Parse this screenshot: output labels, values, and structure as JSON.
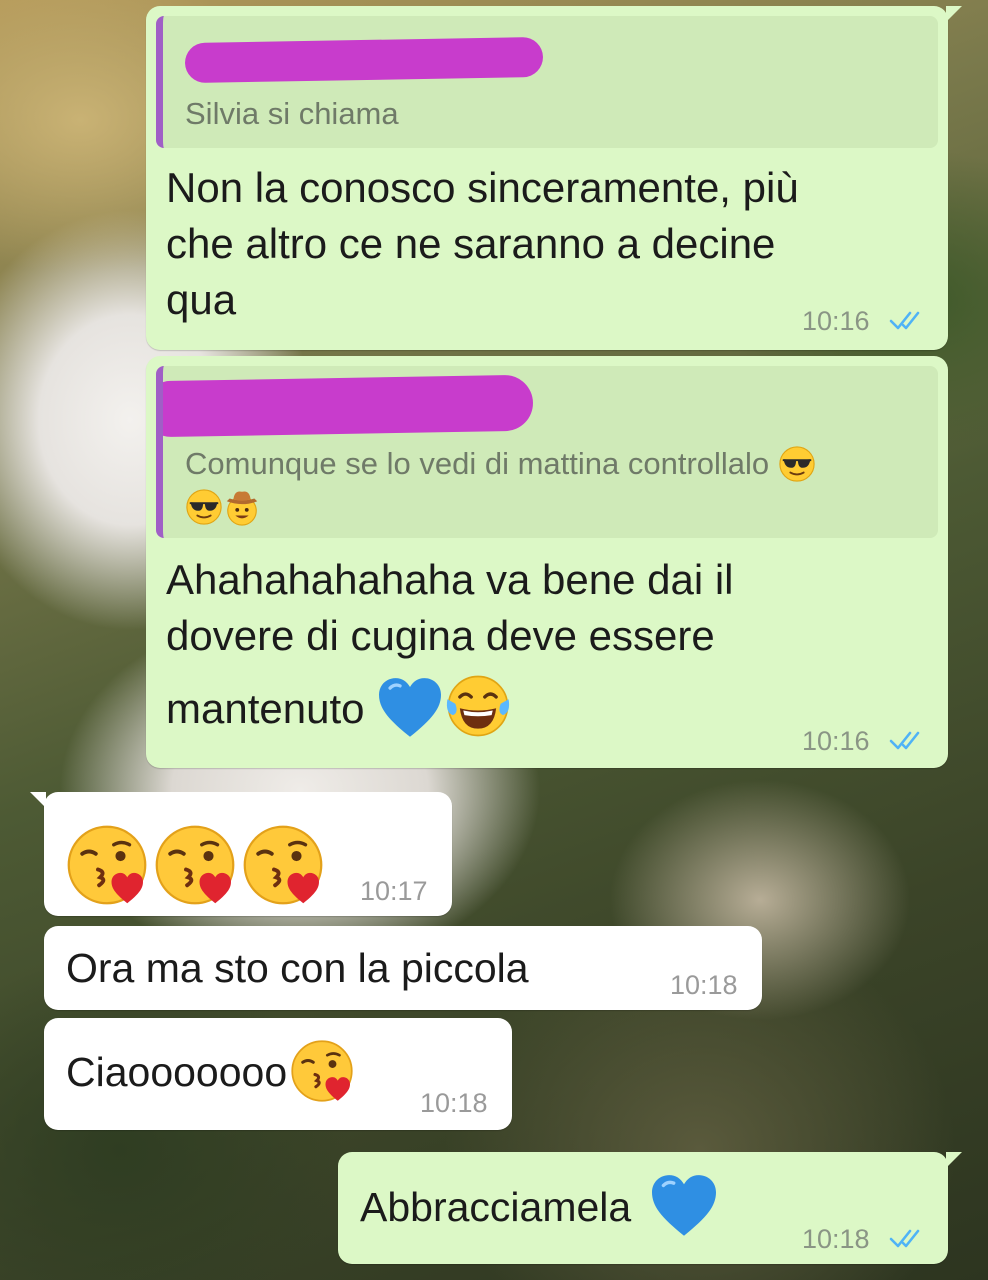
{
  "messages": [
    {
      "direction": "outgoing",
      "quote": {
        "text": "Silvia si chiama"
      },
      "text": "Non la conosco sinceramente, più che altro ce ne saranno a decine qua",
      "lines": [
        "Non la conosco sinceramente, più",
        "che altro ce ne saranno a decine",
        "qua"
      ],
      "time": "10:16",
      "status": "read"
    },
    {
      "direction": "outgoing",
      "quote": {
        "text": "Comunque se lo vedi di mattina controllalo",
        "emojis": [
          "smiling-face-with-sunglasses",
          "smiling-face-with-sunglasses",
          "cowboy-hat-face"
        ]
      },
      "text": "Ahahahahahaha va bene dai il dovere di cugina deve essere mantenuto",
      "lines": [
        "Ahahahahahaha va bene dai il",
        "dovere di cugina deve essere",
        "mantenuto"
      ],
      "emojis": [
        "blue-heart",
        "face-with-tears-of-joy"
      ],
      "time": "10:16",
      "status": "read"
    },
    {
      "direction": "incoming",
      "emojis": [
        "face-blowing-a-kiss",
        "face-blowing-a-kiss",
        "face-blowing-a-kiss"
      ],
      "time": "10:17"
    },
    {
      "direction": "incoming",
      "text": "Ora ma sto con la piccola",
      "time": "10:18"
    },
    {
      "direction": "incoming",
      "text": "Ciaooooooo",
      "emojis": [
        "face-blowing-a-kiss"
      ],
      "time": "10:18"
    },
    {
      "direction": "outgoing",
      "text": "Abbracciamela",
      "emojis": [
        "blue-heart"
      ],
      "time": "10:18",
      "status": "read"
    }
  ],
  "colors": {
    "outgoing_bubble": "#dcf8c6",
    "incoming_bubble": "#ffffff",
    "quote_bar": "#a05fc6",
    "redaction": "#c83ccc",
    "read_ticks": "#4fb3f6"
  }
}
